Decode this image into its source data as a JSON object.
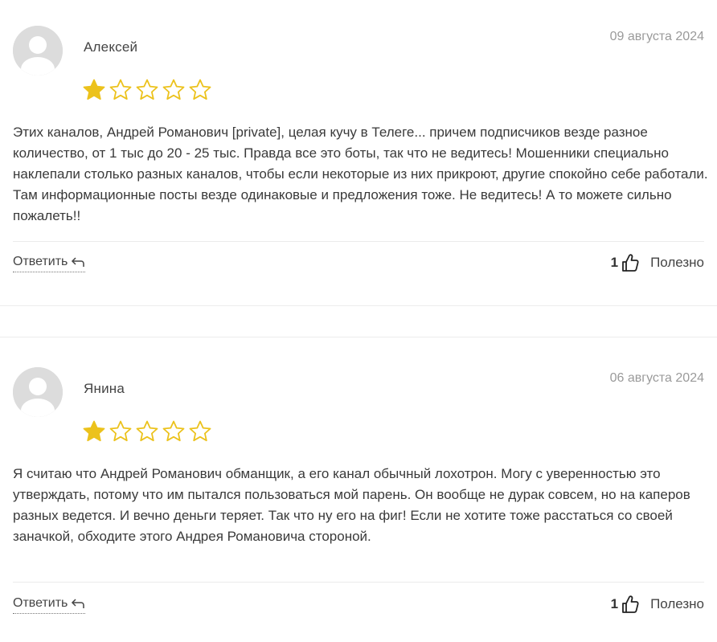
{
  "reviews": [
    {
      "author": "Алексей",
      "date": "09 августа 2024",
      "rating": 1,
      "max_rating": 5,
      "text": "Этих каналов, Андрей Романович [private], целая кучу в Телеге... причем подписчиков везде разное количество, от 1 тыс до 20 - 25 тыс. Правда все это боты, так что не ведитесь! Мошенники специально наклепали столько разных каналов, чтобы если некоторые из них прикроют, другие спокойно себе работали. Там информационные посты везде одинаковые и предложения тоже. Не ведитесь! А то можете сильно пожалеть!!",
      "reply_label": "Ответить",
      "likes": "1",
      "useful_label": "Полезно"
    },
    {
      "author": "Янина",
      "date": "06 августа 2024",
      "rating": 1,
      "max_rating": 5,
      "text": "Я считаю что Андрей Романович обманщик, а его канал обычный лохотрон. Могу с уверенностью это утверждать, потому что им пытался пользоваться мой парень. Он вообще не дурак совсем, но на каперов разных ведется. И вечно деньги теряет. Так что ну его на фиг! Если не хотите тоже расстаться со своей заначкой, обходите этого Андрея Романовича стороной.",
      "reply_label": "Ответить",
      "likes": "1",
      "useful_label": "Полезно"
    }
  ],
  "colors": {
    "star_filled": "#ECC21C",
    "star_outline": "#ECC21C",
    "avatar_bg": "#DCDCDC",
    "avatar_fg": "#FFFFFF",
    "date": "#9A9A9A"
  },
  "icons": {
    "avatar": "user-silhouette-icon",
    "star": "star-icon",
    "reply": "reply-arrow-icon",
    "like": "thumbs-up-icon"
  }
}
